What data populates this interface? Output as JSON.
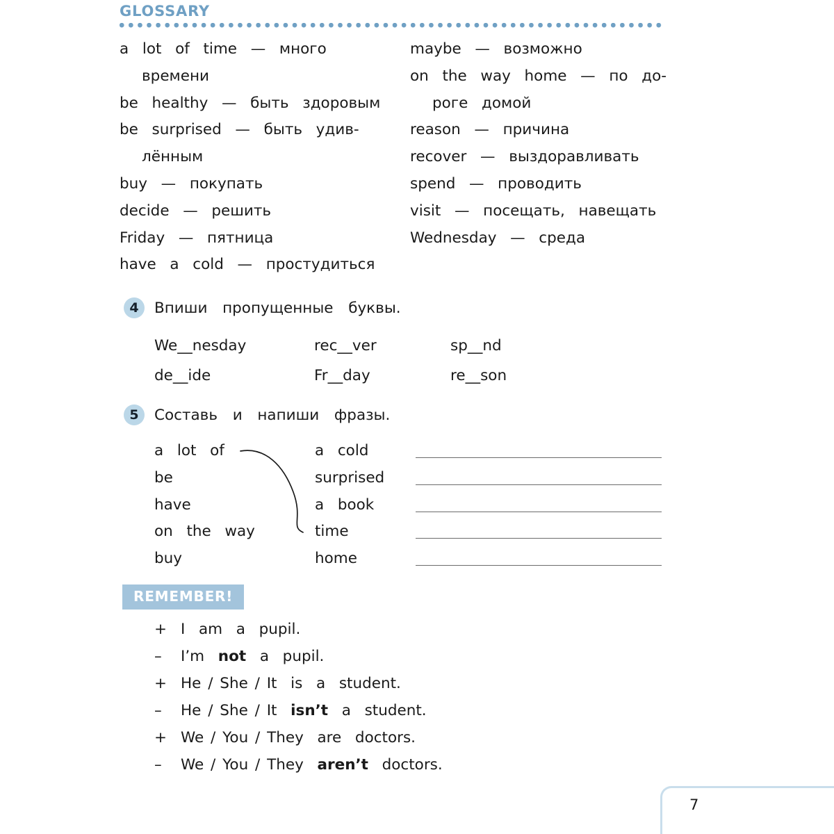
{
  "glossary": {
    "title": "GLOSSARY",
    "left_column": [
      {
        "text": "a  lot  of  time  —  много",
        "continuation": false
      },
      {
        "text": "времени",
        "continuation": true
      },
      {
        "text": "be  healthy  —  быть  здоровым",
        "continuation": false
      },
      {
        "text": "be  surprised  —  быть  удив-",
        "continuation": false
      },
      {
        "text": "лённым",
        "continuation": true
      },
      {
        "text": "buy  —  покупать",
        "continuation": false
      },
      {
        "text": "decide  —  решить",
        "continuation": false
      },
      {
        "text": "Friday  —  пятница",
        "continuation": false
      },
      {
        "text": "have  a  cold  —  простудиться",
        "continuation": false
      }
    ],
    "right_column": [
      {
        "text": "maybe  —  возможно",
        "continuation": false
      },
      {
        "text": "on  the  way  home  —  по  до-",
        "continuation": false
      },
      {
        "text": "роге  домой",
        "continuation": true
      },
      {
        "text": "reason  —  причина",
        "continuation": false
      },
      {
        "text": "recover  —  выздоравливать",
        "continuation": false
      },
      {
        "text": "spend  —  проводить",
        "continuation": false
      },
      {
        "text": "visit  —  посещать,  навещать",
        "continuation": false
      },
      {
        "text": "Wednesday  —  среда",
        "continuation": false
      }
    ]
  },
  "exercise4": {
    "number": "4",
    "prompt": "Впиши  пропущенные  буквы.",
    "rows": [
      [
        "We__nesday",
        "rec__ver",
        "sp__nd"
      ],
      [
        "de__ide",
        "Fr__day",
        "re__son"
      ]
    ]
  },
  "exercise5": {
    "number": "5",
    "prompt": "Составь  и  напиши  фразы.",
    "rows": [
      {
        "left": "a  lot  of",
        "right": "a  cold"
      },
      {
        "left": "be",
        "right": "surprised"
      },
      {
        "left": "have",
        "right": "a  book"
      },
      {
        "left": "on  the  way",
        "right": "time"
      },
      {
        "left": "buy",
        "right": "home"
      }
    ],
    "match_curve": {
      "from_index": 0,
      "to_index": 3
    },
    "answer_lines": 5
  },
  "remember": {
    "title": "REMEMBER!",
    "lines": [
      {
        "sign": "+",
        "before": "I  am  a  pupil.",
        "bold": "",
        "after": ""
      },
      {
        "sign": "–",
        "before": "I’m  ",
        "bold": "not",
        "after": "  a  pupil."
      },
      {
        "sign": "+",
        "before": "He / She / It  is  a  student.",
        "bold": "",
        "after": ""
      },
      {
        "sign": "–",
        "before": "He / She / It  ",
        "bold": "isn’t",
        "after": "  a  student."
      },
      {
        "sign": "+",
        "before": "We / You / They  are  doctors.",
        "bold": "",
        "after": ""
      },
      {
        "sign": "–",
        "before": "We / You / They  ",
        "bold": "aren’t",
        "after": "  doctors."
      }
    ]
  },
  "footer": {
    "page_number": "7"
  },
  "colors": {
    "accent_blue": "#6FA0C4",
    "badge_blue": "#BBD7E8",
    "remember_blue": "#A3C4DC",
    "corner_blue": "#C9DEEC",
    "rule_gray": "#6b6b6b",
    "text_black": "#1a1a1a"
  }
}
